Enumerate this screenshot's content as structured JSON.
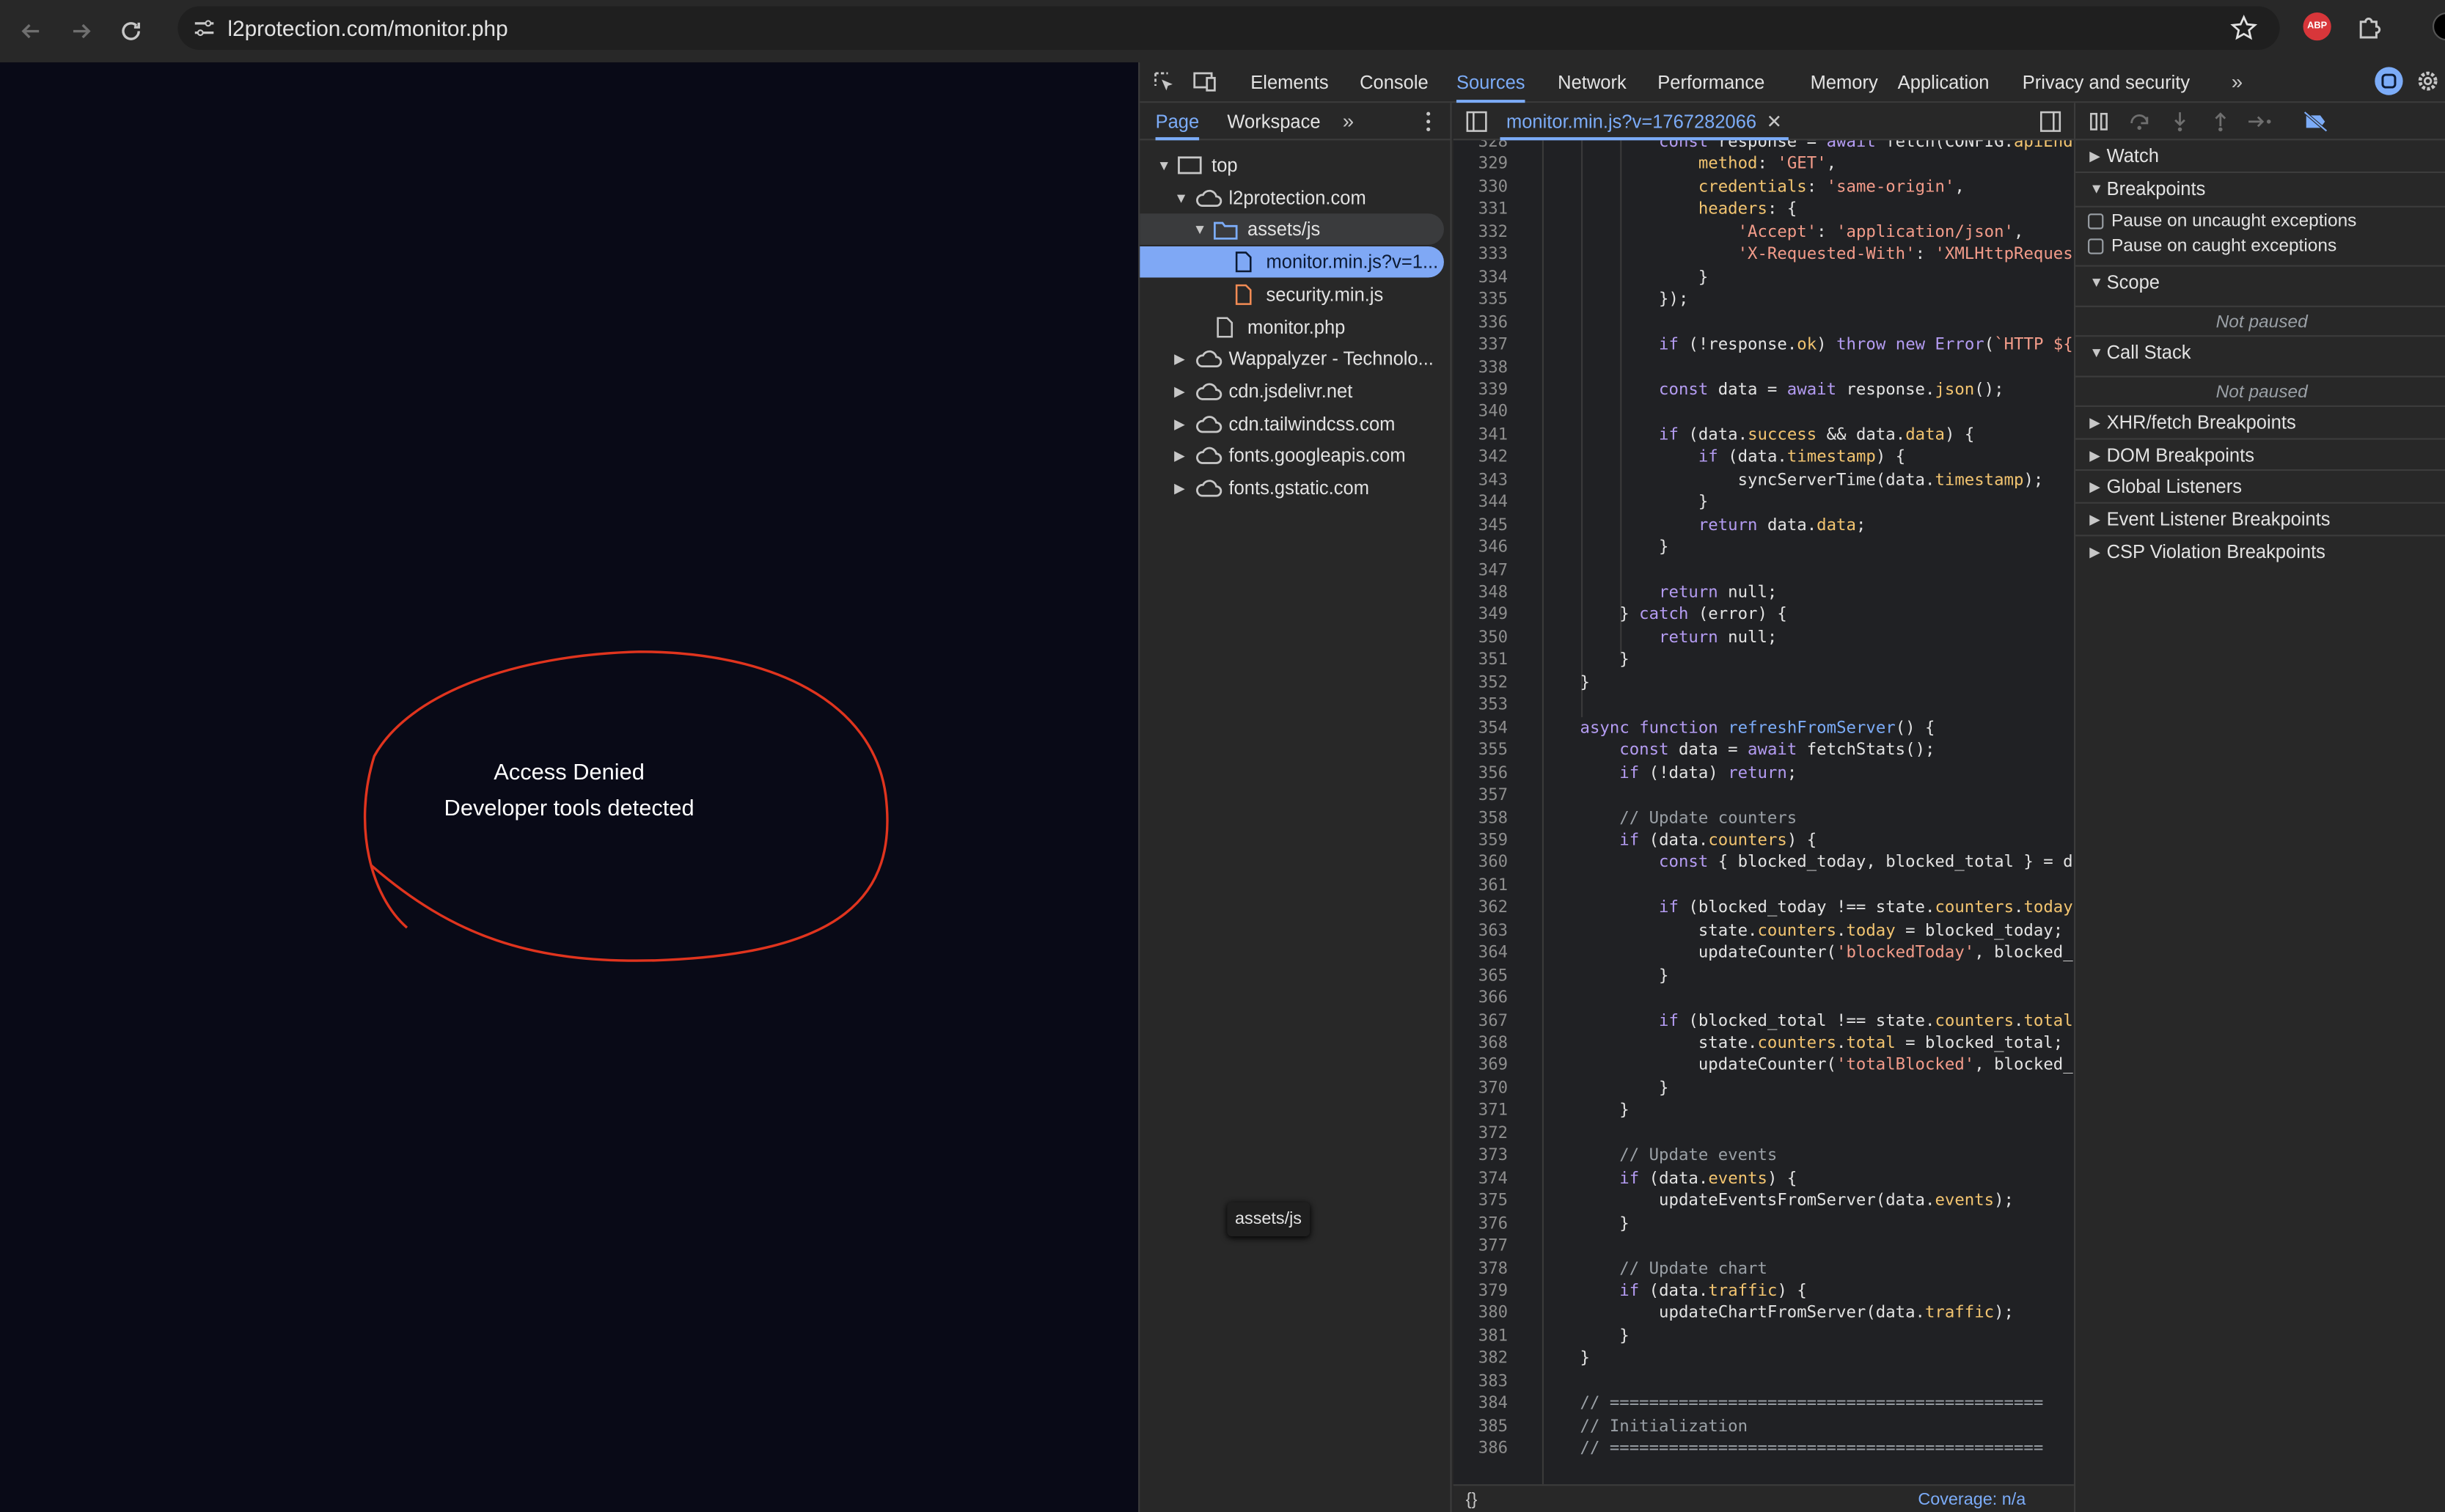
{
  "browser": {
    "url": "l2protection.com/monitor.php"
  },
  "page": {
    "denied_title": "Access Denied",
    "denied_subtitle": "Developer tools detected"
  },
  "devtools": {
    "tabs": [
      "Elements",
      "Console",
      "Sources",
      "Network",
      "Performance",
      "Memory",
      "Application",
      "Privacy and security"
    ],
    "active_tab": "Sources",
    "navigator": {
      "tabs": [
        "Page",
        "Workspace"
      ],
      "tree": [
        {
          "label": "top",
          "depth": 0,
          "icon": "frame-icon",
          "expanded": true
        },
        {
          "label": "l2protection.com",
          "depth": 1,
          "icon": "cloud-icon",
          "expanded": true
        },
        {
          "label": "assets/js",
          "depth": 2,
          "icon": "folder-icon",
          "expanded": true
        },
        {
          "label": "monitor.min.js?v=1...",
          "depth": 3,
          "icon": "file-icon",
          "selected": true
        },
        {
          "label": "security.min.js",
          "depth": 3,
          "icon": "file-icon"
        },
        {
          "label": "monitor.php",
          "depth": 2,
          "icon": "file-icon"
        },
        {
          "label": "Wappalyzer - Technolo...",
          "depth": 1,
          "icon": "cloud-icon",
          "expanded": false
        },
        {
          "label": "cdn.jsdelivr.net",
          "depth": 1,
          "icon": "cloud-icon",
          "expanded": false
        },
        {
          "label": "cdn.tailwindcss.com",
          "depth": 1,
          "icon": "cloud-icon",
          "expanded": false
        },
        {
          "label": "fonts.googleapis.com",
          "depth": 1,
          "icon": "cloud-icon",
          "expanded": false
        },
        {
          "label": "fonts.gstatic.com",
          "depth": 1,
          "icon": "cloud-icon",
          "expanded": false
        }
      ],
      "tooltip": "assets/js"
    },
    "editor": {
      "file_tab": "monitor.min.js?v=1767282066",
      "footer_braces": "{}",
      "coverage": "Coverage: n/a",
      "lines": [
        {
          "n": 328,
          "t": "            const response = await fetch(CONFIG.apiEndp"
        },
        {
          "n": 329,
          "t": "                method: 'GET',"
        },
        {
          "n": 330,
          "t": "                credentials: 'same-origin',"
        },
        {
          "n": 331,
          "t": "                headers: {"
        },
        {
          "n": 332,
          "t": "                    'Accept': 'application/json',"
        },
        {
          "n": 333,
          "t": "                    'X-Requested-With': 'XMLHttpRequest"
        },
        {
          "n": 334,
          "t": "                }"
        },
        {
          "n": 335,
          "t": "            });"
        },
        {
          "n": 336,
          "t": ""
        },
        {
          "n": 337,
          "t": "            if (!response.ok) throw new Error(`HTTP ${r"
        },
        {
          "n": 338,
          "t": ""
        },
        {
          "n": 339,
          "t": "            const data = await response.json();"
        },
        {
          "n": 340,
          "t": ""
        },
        {
          "n": 341,
          "t": "            if (data.success && data.data) {"
        },
        {
          "n": 342,
          "t": "                if (data.timestamp) {"
        },
        {
          "n": 343,
          "t": "                    syncServerTime(data.timestamp);"
        },
        {
          "n": 344,
          "t": "                }"
        },
        {
          "n": 345,
          "t": "                return data.data;"
        },
        {
          "n": 346,
          "t": "            }"
        },
        {
          "n": 347,
          "t": ""
        },
        {
          "n": 348,
          "t": "            return null;"
        },
        {
          "n": 349,
          "t": "        } catch (error) {"
        },
        {
          "n": 350,
          "t": "            return null;"
        },
        {
          "n": 351,
          "t": "        }"
        },
        {
          "n": 352,
          "t": "    }"
        },
        {
          "n": 353,
          "t": ""
        },
        {
          "n": 354,
          "t": "    async function refreshFromServer() {"
        },
        {
          "n": 355,
          "t": "        const data = await fetchStats();"
        },
        {
          "n": 356,
          "t": "        if (!data) return;"
        },
        {
          "n": 357,
          "t": ""
        },
        {
          "n": 358,
          "t": "        // Update counters"
        },
        {
          "n": 359,
          "t": "        if (data.counters) {"
        },
        {
          "n": 360,
          "t": "            const { blocked_today, blocked_total } = da"
        },
        {
          "n": 361,
          "t": ""
        },
        {
          "n": 362,
          "t": "            if (blocked_today !== state.counters.today)"
        },
        {
          "n": 363,
          "t": "                state.counters.today = blocked_today;"
        },
        {
          "n": 364,
          "t": "                updateCounter('blockedToday', blocked_t"
        },
        {
          "n": 365,
          "t": "            }"
        },
        {
          "n": 366,
          "t": ""
        },
        {
          "n": 367,
          "t": "            if (blocked_total !== state.counters.total)"
        },
        {
          "n": 368,
          "t": "                state.counters.total = blocked_total;"
        },
        {
          "n": 369,
          "t": "                updateCounter('totalBlocked', blocked_t"
        },
        {
          "n": 370,
          "t": "            }"
        },
        {
          "n": 371,
          "t": "        }"
        },
        {
          "n": 372,
          "t": ""
        },
        {
          "n": 373,
          "t": "        // Update events"
        },
        {
          "n": 374,
          "t": "        if (data.events) {"
        },
        {
          "n": 375,
          "t": "            updateEventsFromServer(data.events);"
        },
        {
          "n": 376,
          "t": "        }"
        },
        {
          "n": 377,
          "t": ""
        },
        {
          "n": 378,
          "t": "        // Update chart"
        },
        {
          "n": 379,
          "t": "        if (data.traffic) {"
        },
        {
          "n": 380,
          "t": "            updateChartFromServer(data.traffic);"
        },
        {
          "n": 381,
          "t": "        }"
        },
        {
          "n": 382,
          "t": "    }"
        },
        {
          "n": 383,
          "t": ""
        },
        {
          "n": 384,
          "t": "    // ============================================"
        },
        {
          "n": 385,
          "t": "    // Initialization"
        },
        {
          "n": 386,
          "t": "    // ============================================"
        }
      ]
    },
    "sidebar": {
      "watch": "Watch",
      "breakpoints": "Breakpoints",
      "pause_uncaught": "Pause on uncaught exceptions",
      "pause_caught": "Pause on caught exceptions",
      "scope": "Scope",
      "scope_status": "Not paused",
      "call_stack": "Call Stack",
      "call_stack_status": "Not paused",
      "sections": [
        "XHR/fetch Breakpoints",
        "DOM Breakpoints",
        "Global Listeners",
        "Event Listener Breakpoints",
        "CSP Violation Breakpoints"
      ]
    }
  },
  "colors": {
    "accent": "#7cacf8",
    "selected_row": "#7fa8f5",
    "scribble": "#e0341e",
    "page_bg": "#090a17"
  }
}
